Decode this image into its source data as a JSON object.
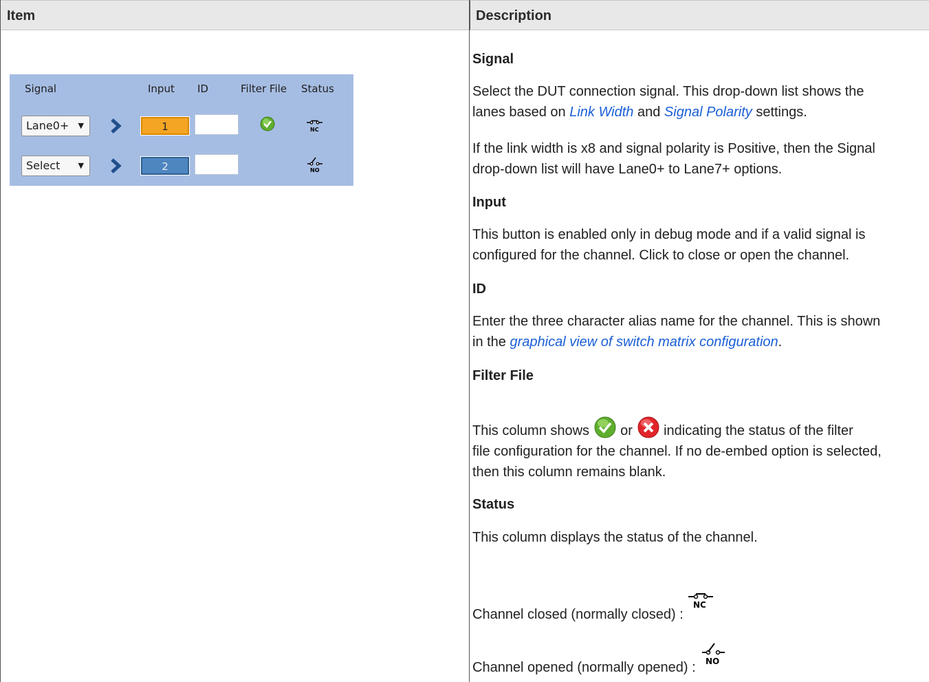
{
  "table": {
    "header_item": "Item",
    "header_description": "Description"
  },
  "panel": {
    "labels": {
      "signal": "Signal",
      "input": "Input",
      "id": "ID",
      "filter_file": "Filter File",
      "status": "Status"
    },
    "rows": [
      {
        "signal": "Lane0+",
        "input": "1",
        "input_color": "#f5a524",
        "filter": "check-icon",
        "status": "NC"
      },
      {
        "signal": "Select",
        "input": "2",
        "input_color": "#4e86c0",
        "filter": "",
        "status": "NO"
      }
    ],
    "background": "#a6bde3"
  },
  "desc": {
    "signal": {
      "heading": "Signal",
      "p1_a": "Select the DUT connection signal. This drop-down list shows the",
      "p1_b_pre": "lanes based on ",
      "link_width": "Link Width",
      "p1_b_mid": " and ",
      "signal_polarity": "Signal Polarity",
      "p1_b_post": " settings.",
      "p2_a": "If the link width is x8 and signal polarity is Positive, then the Signal",
      "p2_b": "drop-down list will have Lane0+ to Lane7+ options."
    },
    "input": {
      "heading": "Input",
      "p1_a": "This button is enabled only in debug mode and if a valid signal is",
      "p1_b": "configured for the channel. Click to close or open the channel."
    },
    "id": {
      "heading": "ID",
      "p1_a": "Enter the three character alias name for the channel. This is shown",
      "p1_b_pre": "in the ",
      "link_graphical": "graphical view of switch matrix configuration",
      "p1_b_post": "."
    },
    "filter": {
      "heading": "Filter File",
      "p1_pre": "This column shows ",
      "p1_or": " or ",
      "p1_post": " indicating the status of the filter",
      "p2": "file configuration for the channel. If no de-embed option is selected,",
      "p3": "then this column remains blank."
    },
    "status": {
      "heading": "Status",
      "p1": "This column displays the status of the channel.",
      "closed": "Channel closed (normally closed) :",
      "opened": "Channel opened (normally opened) :",
      "nc": "NC",
      "no": "NO"
    }
  }
}
